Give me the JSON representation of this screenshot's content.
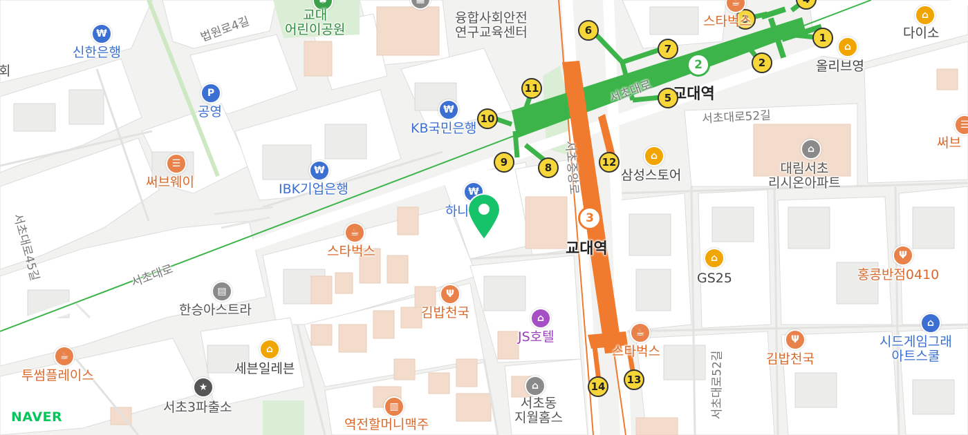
{
  "map": {
    "colors": {
      "background": "#f2f2f0",
      "block": "#ffffff",
      "building": "#e9e9e7",
      "road": "#ffffff",
      "line2": "#3cb44a",
      "line3": "#f07a2e",
      "park": "#d9eed4",
      "brown_building": "#f3dccb",
      "pin": "#17c36a"
    },
    "logo": "NAVER",
    "stations": [
      {
        "name": "교대역",
        "line": "2"
      },
      {
        "name": "교대역",
        "line": "3"
      }
    ],
    "exits": [
      "1",
      "2",
      "3",
      "4",
      "5",
      "6",
      "7",
      "8",
      "9",
      "10",
      "11",
      "12",
      "13",
      "14"
    ],
    "roads": [
      "법원로4길",
      "서초대로",
      "서초중앙로",
      "서초대로52길",
      "서초대로45길",
      "서초대로52길"
    ],
    "pois": [
      {
        "label": "신한은행",
        "icon": "bank-icon",
        "color": "#3b6fd1"
      },
      {
        "label": "공영",
        "icon": "parking-icon",
        "color": "#3b6fd1"
      },
      {
        "label": "교대\n어린이공원",
        "icon": "park-icon",
        "color": "#3aa04a"
      },
      {
        "label": "융합사회안전\n연구교육센터",
        "icon": "building-icon",
        "color": "#777777"
      },
      {
        "label": "KB국민은행",
        "icon": "bank-icon",
        "color": "#3b6fd1"
      },
      {
        "label": "IBK기업은행",
        "icon": "bank-icon",
        "color": "#3b6fd1"
      },
      {
        "label": "써브웨이",
        "icon": "burger-icon",
        "color": "#e8824a"
      },
      {
        "label": "하나은행",
        "icon": "bank-icon",
        "color": "#3b6fd1"
      },
      {
        "label": "스타벅스",
        "icon": "cafe-icon",
        "color": "#e8824a"
      },
      {
        "label": "한승아스트라",
        "icon": "office-icon",
        "color": "#777777"
      },
      {
        "label": "김밥천국",
        "icon": "restaurant-icon",
        "color": "#e8824a"
      },
      {
        "label": "JS호텔",
        "icon": "hotel-icon",
        "color": "#a64fc4"
      },
      {
        "label": "투썸플레이스",
        "icon": "cafe-icon",
        "color": "#e8824a"
      },
      {
        "label": "세븐일레븐",
        "icon": "store-icon",
        "color": "#f0a500"
      },
      {
        "label": "서초3파출소",
        "icon": "police-icon",
        "color": "#555555"
      },
      {
        "label": "역전할머니맥주",
        "icon": "bar-icon",
        "color": "#e8824a"
      },
      {
        "label": "서초동\n지월홈스",
        "icon": "home-icon",
        "color": "#777777"
      },
      {
        "label": "스타벅스",
        "icon": "cafe-icon",
        "color": "#e8824a"
      },
      {
        "label": "삼성스토어",
        "icon": "shop-icon",
        "color": "#f0a500"
      },
      {
        "label": "대림서초\n리시온아파트",
        "icon": "home-icon",
        "color": "#777777"
      },
      {
        "label": "GS25",
        "icon": "store-icon",
        "color": "#f0a500"
      },
      {
        "label": "김밥천국",
        "icon": "restaurant-icon",
        "color": "#e8824a"
      },
      {
        "label": "홍콩반점0410",
        "icon": "restaurant-icon",
        "color": "#e8824a"
      },
      {
        "label": "시드게임그래\n아트스쿨",
        "icon": "school-icon",
        "color": "#3b6fd1"
      },
      {
        "label": "스타벅스",
        "icon": "cafe-icon",
        "color": "#e8824a"
      },
      {
        "label": "올리브영",
        "icon": "shop-icon",
        "color": "#f0a500"
      },
      {
        "label": "다이소",
        "icon": "shop-icon",
        "color": "#f0a500"
      },
      {
        "label": "써브",
        "icon": "burger-icon",
        "color": "#e8824a"
      },
      {
        "label": "회",
        "icon": "",
        "color": "#555555"
      }
    ]
  }
}
